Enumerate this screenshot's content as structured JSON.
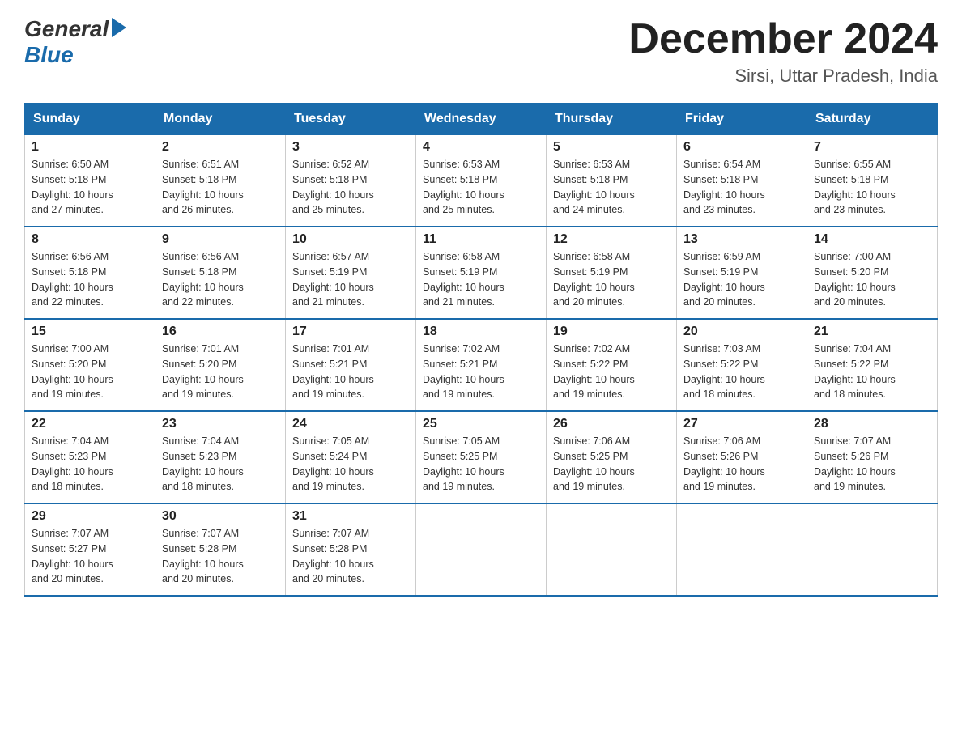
{
  "header": {
    "logo_general": "General",
    "logo_blue": "Blue",
    "month_title": "December 2024",
    "location": "Sirsi, Uttar Pradesh, India"
  },
  "days_of_week": [
    "Sunday",
    "Monday",
    "Tuesday",
    "Wednesday",
    "Thursday",
    "Friday",
    "Saturday"
  ],
  "weeks": [
    [
      {
        "day": "1",
        "sunrise": "6:50 AM",
        "sunset": "5:18 PM",
        "daylight": "10 hours and 27 minutes."
      },
      {
        "day": "2",
        "sunrise": "6:51 AM",
        "sunset": "5:18 PM",
        "daylight": "10 hours and 26 minutes."
      },
      {
        "day": "3",
        "sunrise": "6:52 AM",
        "sunset": "5:18 PM",
        "daylight": "10 hours and 25 minutes."
      },
      {
        "day": "4",
        "sunrise": "6:53 AM",
        "sunset": "5:18 PM",
        "daylight": "10 hours and 25 minutes."
      },
      {
        "day": "5",
        "sunrise": "6:53 AM",
        "sunset": "5:18 PM",
        "daylight": "10 hours and 24 minutes."
      },
      {
        "day": "6",
        "sunrise": "6:54 AM",
        "sunset": "5:18 PM",
        "daylight": "10 hours and 23 minutes."
      },
      {
        "day": "7",
        "sunrise": "6:55 AM",
        "sunset": "5:18 PM",
        "daylight": "10 hours and 23 minutes."
      }
    ],
    [
      {
        "day": "8",
        "sunrise": "6:56 AM",
        "sunset": "5:18 PM",
        "daylight": "10 hours and 22 minutes."
      },
      {
        "day": "9",
        "sunrise": "6:56 AM",
        "sunset": "5:18 PM",
        "daylight": "10 hours and 22 minutes."
      },
      {
        "day": "10",
        "sunrise": "6:57 AM",
        "sunset": "5:19 PM",
        "daylight": "10 hours and 21 minutes."
      },
      {
        "day": "11",
        "sunrise": "6:58 AM",
        "sunset": "5:19 PM",
        "daylight": "10 hours and 21 minutes."
      },
      {
        "day": "12",
        "sunrise": "6:58 AM",
        "sunset": "5:19 PM",
        "daylight": "10 hours and 20 minutes."
      },
      {
        "day": "13",
        "sunrise": "6:59 AM",
        "sunset": "5:19 PM",
        "daylight": "10 hours and 20 minutes."
      },
      {
        "day": "14",
        "sunrise": "7:00 AM",
        "sunset": "5:20 PM",
        "daylight": "10 hours and 20 minutes."
      }
    ],
    [
      {
        "day": "15",
        "sunrise": "7:00 AM",
        "sunset": "5:20 PM",
        "daylight": "10 hours and 19 minutes."
      },
      {
        "day": "16",
        "sunrise": "7:01 AM",
        "sunset": "5:20 PM",
        "daylight": "10 hours and 19 minutes."
      },
      {
        "day": "17",
        "sunrise": "7:01 AM",
        "sunset": "5:21 PM",
        "daylight": "10 hours and 19 minutes."
      },
      {
        "day": "18",
        "sunrise": "7:02 AM",
        "sunset": "5:21 PM",
        "daylight": "10 hours and 19 minutes."
      },
      {
        "day": "19",
        "sunrise": "7:02 AM",
        "sunset": "5:22 PM",
        "daylight": "10 hours and 19 minutes."
      },
      {
        "day": "20",
        "sunrise": "7:03 AM",
        "sunset": "5:22 PM",
        "daylight": "10 hours and 18 minutes."
      },
      {
        "day": "21",
        "sunrise": "7:04 AM",
        "sunset": "5:22 PM",
        "daylight": "10 hours and 18 minutes."
      }
    ],
    [
      {
        "day": "22",
        "sunrise": "7:04 AM",
        "sunset": "5:23 PM",
        "daylight": "10 hours and 18 minutes."
      },
      {
        "day": "23",
        "sunrise": "7:04 AM",
        "sunset": "5:23 PM",
        "daylight": "10 hours and 18 minutes."
      },
      {
        "day": "24",
        "sunrise": "7:05 AM",
        "sunset": "5:24 PM",
        "daylight": "10 hours and 19 minutes."
      },
      {
        "day": "25",
        "sunrise": "7:05 AM",
        "sunset": "5:25 PM",
        "daylight": "10 hours and 19 minutes."
      },
      {
        "day": "26",
        "sunrise": "7:06 AM",
        "sunset": "5:25 PM",
        "daylight": "10 hours and 19 minutes."
      },
      {
        "day": "27",
        "sunrise": "7:06 AM",
        "sunset": "5:26 PM",
        "daylight": "10 hours and 19 minutes."
      },
      {
        "day": "28",
        "sunrise": "7:07 AM",
        "sunset": "5:26 PM",
        "daylight": "10 hours and 19 minutes."
      }
    ],
    [
      {
        "day": "29",
        "sunrise": "7:07 AM",
        "sunset": "5:27 PM",
        "daylight": "10 hours and 20 minutes."
      },
      {
        "day": "30",
        "sunrise": "7:07 AM",
        "sunset": "5:28 PM",
        "daylight": "10 hours and 20 minutes."
      },
      {
        "day": "31",
        "sunrise": "7:07 AM",
        "sunset": "5:28 PM",
        "daylight": "10 hours and 20 minutes."
      },
      null,
      null,
      null,
      null
    ]
  ],
  "labels": {
    "sunrise": "Sunrise:",
    "sunset": "Sunset:",
    "daylight": "Daylight:"
  }
}
